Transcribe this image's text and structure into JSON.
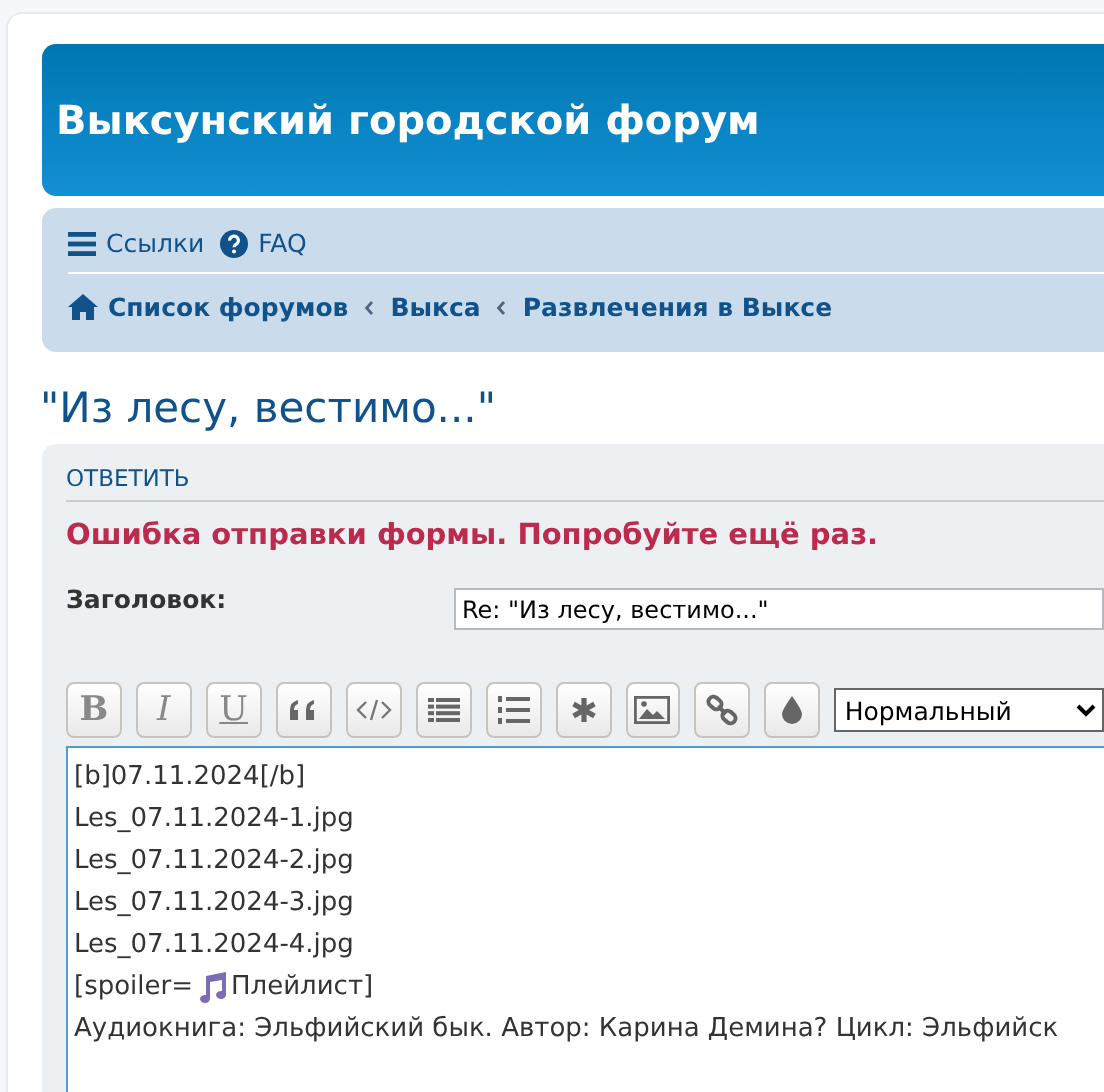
{
  "header": {
    "site_title": "Выксунский городской форум"
  },
  "navbar": {
    "links": [
      {
        "label": "Ссылки",
        "kind": "menu"
      },
      {
        "label": "FAQ",
        "kind": "help"
      }
    ],
    "breadcrumbs": [
      "Список форумов",
      "Выкса",
      "Развлечения в Выксе"
    ]
  },
  "topic_title": "\"Из лесу, вестимо...\"",
  "reply_panel": {
    "heading": "ОТВЕТИТЬ",
    "error": "Ошибка отправки формы. Попробуйте ещё раз.",
    "subject_label": "Заголовок:",
    "subject_value": "Re: \"Из лесу, вестимо...\"",
    "format_buttons": [
      {
        "label": "B",
        "kind": "bold"
      },
      {
        "label": "I",
        "kind": "italic"
      },
      {
        "label": "U",
        "kind": "underline"
      }
    ],
    "size_select": "Нормальный",
    "message_lines": [
      {
        "kind": "plain",
        "text": "[b]07.11.2024[/b]"
      },
      {
        "kind": "plain",
        "text": "Les_07.11.2024-1.jpg"
      },
      {
        "kind": "plain",
        "text": "Les_07.11.2024-2.jpg"
      },
      {
        "kind": "plain",
        "text": "Les_07.11.2024-3.jpg"
      },
      {
        "kind": "plain",
        "text": "Les_07.11.2024-4.jpg"
      },
      {
        "kind": "note",
        "text": "[spoiler=",
        "after": "Плейлист]"
      },
      {
        "kind": "plain",
        "text": "Аудиокнига: Эльфийский бык. Автор: Карина Демина? Цикл: Эльфийск"
      }
    ]
  }
}
